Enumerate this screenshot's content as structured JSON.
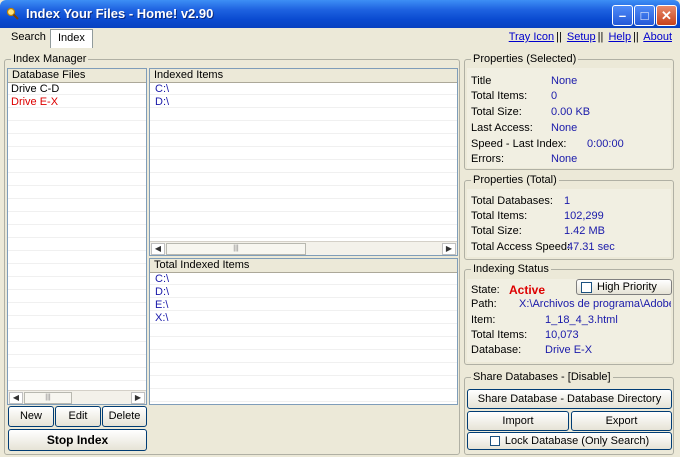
{
  "window": {
    "title": "Index Your Files - Home! v2.90"
  },
  "tabs": [
    {
      "label": "Search"
    },
    {
      "label": "Index"
    }
  ],
  "top_links": [
    {
      "label": "Tray Icon"
    },
    {
      "label": "Setup"
    },
    {
      "label": "Help"
    },
    {
      "label": "About"
    }
  ],
  "index_manager": {
    "label": "Index Manager",
    "database_files": {
      "header": "Database Files",
      "items": [
        {
          "label": "Drive C-D",
          "selected": false
        },
        {
          "label": "Drive E-X",
          "selected": true
        }
      ]
    },
    "indexed_items": {
      "header": "Indexed Items",
      "items": [
        "C:\\",
        "D:\\"
      ]
    },
    "total_indexed_items": {
      "header": "Total Indexed Items",
      "items": [
        "C:\\",
        "D:\\",
        "E:\\",
        "X:\\"
      ]
    },
    "buttons": {
      "new": "New",
      "edit": "Edit",
      "delete": "Delete",
      "stop": "Stop Index"
    }
  },
  "properties_selected": {
    "label": "Properties (Selected)",
    "rows": [
      {
        "label": "Title",
        "value": "None"
      },
      {
        "label": "Total Items:",
        "value": "0"
      },
      {
        "label": "Total Size:",
        "value": "0.00 KB"
      },
      {
        "label": "Last Access:",
        "value": "None"
      },
      {
        "label": "Speed - Last Index:",
        "value": "0:00:00"
      },
      {
        "label": "Errors:",
        "value": "None"
      }
    ]
  },
  "properties_total": {
    "label": "Properties (Total)",
    "rows": [
      {
        "label": "Total Databases:",
        "value": "1"
      },
      {
        "label": "Total Items:",
        "value": "102,299"
      },
      {
        "label": "Total Size:",
        "value": "1.42 MB"
      },
      {
        "label": "Total Access Speed:",
        "value": "47.31 sec"
      }
    ]
  },
  "indexing_status": {
    "label": "Indexing Status",
    "high_priority_label": "High Priority",
    "state_label": "State:",
    "state_value": "Active",
    "path_label": "Path:",
    "path_value": "X:\\Archivos de programa\\Adobe\\I",
    "item_label": "Item:",
    "item_value": "1_18_4_3.html",
    "total_label": "Total Items:",
    "total_value": "10,073",
    "database_label": "Database:",
    "database_value": "Drive E-X"
  },
  "share": {
    "label": "Share Databases - [Disable]",
    "share_dir_button": "Share Database - Database Directory",
    "import_button": "Import",
    "export_button": "Export",
    "lock_label": "Lock Database (Only Search)"
  },
  "colors": {
    "accent_red": "#dd0000",
    "value_blue": "#1a1aaa"
  }
}
